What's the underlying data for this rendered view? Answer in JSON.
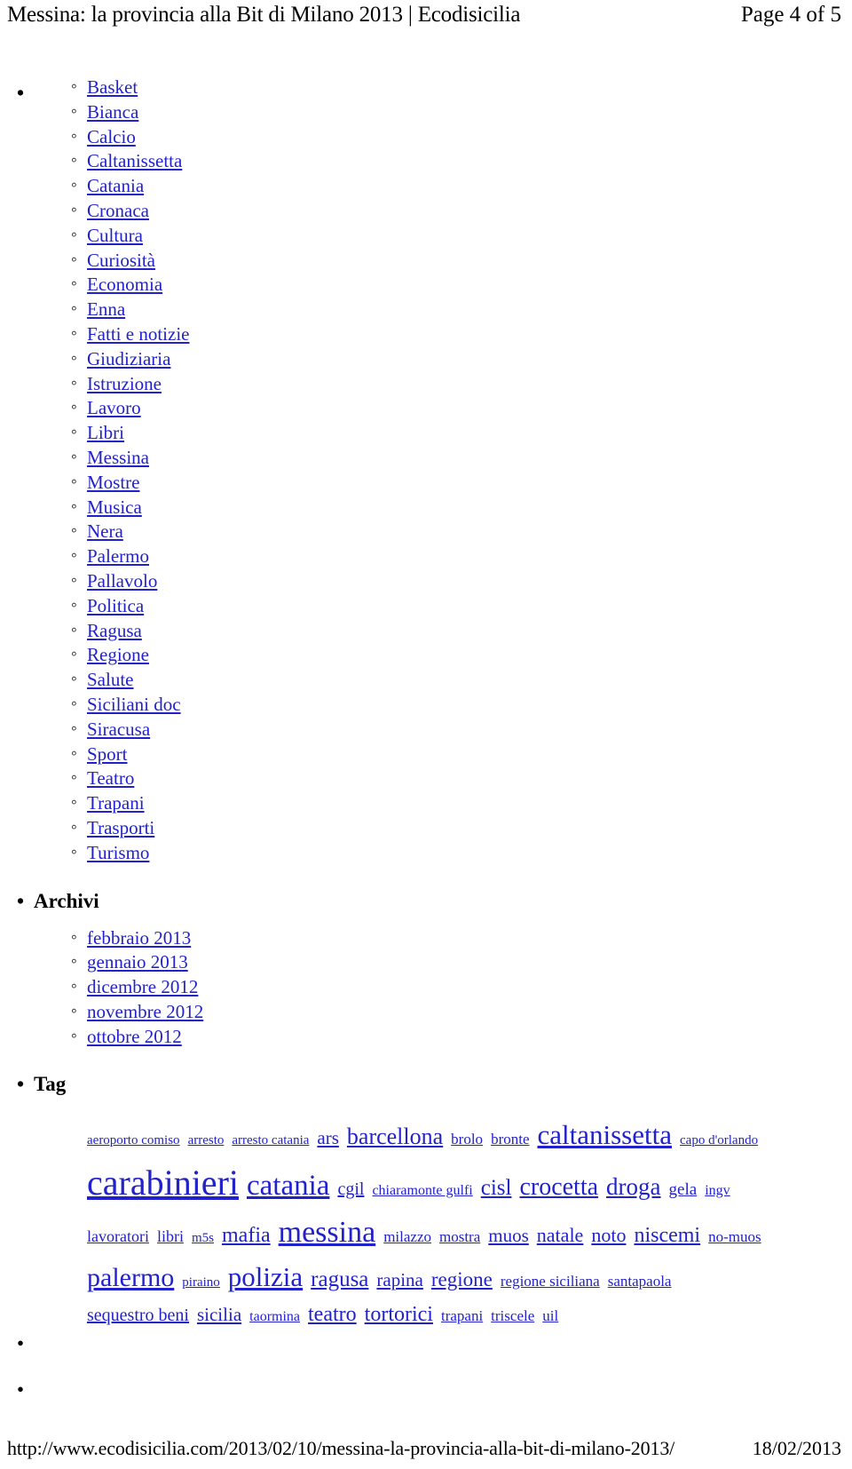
{
  "header": {
    "title": "Messina: la provincia alla Bit di Milano 2013 | Ecodisicilia",
    "page_indicator": "Page 4 of 5"
  },
  "categories": {
    "items": [
      {
        "label": "Basket"
      },
      {
        "label": "Bianca"
      },
      {
        "label": "Calcio"
      },
      {
        "label": "Caltanissetta"
      },
      {
        "label": "Catania"
      },
      {
        "label": "Cronaca"
      },
      {
        "label": "Cultura"
      },
      {
        "label": "Curiosità"
      },
      {
        "label": "Economia"
      },
      {
        "label": "Enna"
      },
      {
        "label": "Fatti e notizie"
      },
      {
        "label": "Giudiziaria"
      },
      {
        "label": "Istruzione"
      },
      {
        "label": "Lavoro"
      },
      {
        "label": "Libri"
      },
      {
        "label": "Messina"
      },
      {
        "label": "Mostre"
      },
      {
        "label": "Musica"
      },
      {
        "label": "Nera"
      },
      {
        "label": "Palermo"
      },
      {
        "label": "Pallavolo"
      },
      {
        "label": "Politica"
      },
      {
        "label": "Ragusa"
      },
      {
        "label": "Regione"
      },
      {
        "label": "Salute"
      },
      {
        "label": "Siciliani doc"
      },
      {
        "label": "Siracusa"
      },
      {
        "label": "Sport"
      },
      {
        "label": "Teatro"
      },
      {
        "label": "Trapani"
      },
      {
        "label": "Trasporti"
      },
      {
        "label": "Turismo"
      }
    ]
  },
  "archives": {
    "heading": "Archivi",
    "items": [
      {
        "label": "febbraio 2013"
      },
      {
        "label": "gennaio 2013"
      },
      {
        "label": "dicembre 2012"
      },
      {
        "label": "novembre 2012"
      },
      {
        "label": "ottobre 2012"
      }
    ]
  },
  "tags": {
    "heading": "Tag",
    "link_color": "#2222cc",
    "items": [
      {
        "label": "aeroporto comiso",
        "size": 15
      },
      {
        "label": "arresto",
        "size": 15
      },
      {
        "label": "arresto catania",
        "size": 15
      },
      {
        "label": "ars",
        "size": 21
      },
      {
        "label": "barcellona",
        "size": 26
      },
      {
        "label": "brolo",
        "size": 17
      },
      {
        "label": "bronte",
        "size": 17
      },
      {
        "label": "caltanissetta",
        "size": 31
      },
      {
        "label": "capo d'orlando",
        "size": 15
      },
      {
        "label": "carabinieri",
        "size": 40
      },
      {
        "label": "catania",
        "size": 33
      },
      {
        "label": "cgil",
        "size": 20
      },
      {
        "label": "chiaramonte gulfi",
        "size": 16
      },
      {
        "label": "cisl",
        "size": 25
      },
      {
        "label": "crocetta",
        "size": 28
      },
      {
        "label": "droga",
        "size": 27
      },
      {
        "label": "gela",
        "size": 19
      },
      {
        "label": "ingv",
        "size": 16
      },
      {
        "label": "lavoratori",
        "size": 18
      },
      {
        "label": "libri",
        "size": 18
      },
      {
        "label": "m5s",
        "size": 15
      },
      {
        "label": "mafia",
        "size": 24
      },
      {
        "label": "messina",
        "size": 34
      },
      {
        "label": "milazzo",
        "size": 17
      },
      {
        "label": "mostra",
        "size": 17
      },
      {
        "label": "muos",
        "size": 21
      },
      {
        "label": "natale",
        "size": 22
      },
      {
        "label": "noto",
        "size": 22
      },
      {
        "label": "niscemi",
        "size": 24
      },
      {
        "label": "no-muos",
        "size": 17
      },
      {
        "label": "palermo",
        "size": 30
      },
      {
        "label": "piraino",
        "size": 15
      },
      {
        "label": "polizia",
        "size": 31
      },
      {
        "label": "ragusa",
        "size": 25
      },
      {
        "label": "rapina",
        "size": 21
      },
      {
        "label": "regione",
        "size": 23
      },
      {
        "label": "regione siciliana",
        "size": 17
      },
      {
        "label": "santapaola",
        "size": 17
      },
      {
        "label": "sequestro beni",
        "size": 20
      },
      {
        "label": "sicilia",
        "size": 21
      },
      {
        "label": "taormina",
        "size": 16
      },
      {
        "label": "teatro",
        "size": 24
      },
      {
        "label": "tortorici",
        "size": 24
      },
      {
        "label": "trapani",
        "size": 17
      },
      {
        "label": "triscele",
        "size": 17
      },
      {
        "label": "uil",
        "size": 17
      }
    ]
  },
  "empty_items": [
    {
      "label": ""
    },
    {
      "label": ""
    }
  ],
  "footer": {
    "url": "http://www.ecodisicilia.com/2013/02/10/messina-la-provincia-alla-bit-di-milano-2013/",
    "date": "18/02/2013"
  }
}
